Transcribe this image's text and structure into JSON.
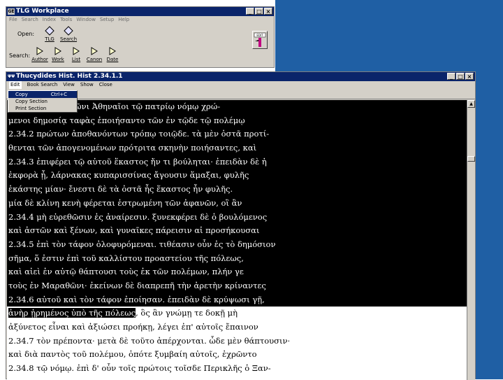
{
  "tlg_window": {
    "title": "TLG Workplace",
    "menu": [
      "File",
      "Search",
      "Index",
      "Tools",
      "Window",
      "Setup",
      "Help"
    ],
    "open_label": "Open:",
    "search_label": "Search:",
    "open_tools": [
      "TLG",
      "Search"
    ],
    "search_tools": [
      "Author",
      "Work",
      "List",
      "Canon",
      "Date"
    ],
    "edit_badge": "EDIT"
  },
  "thuc_window": {
    "title": "Thucydides Hist.   Hist 2.34.1.1",
    "menu": [
      "Edit",
      "Book Search",
      "View",
      "Show",
      "Close"
    ],
    "edit_menu": [
      {
        "label": "Copy",
        "shortcut": "Ctrl+C"
      },
      {
        "label": "Copy Section",
        "shortcut": ""
      },
      {
        "label": "Print Section",
        "shortcut": ""
      }
    ],
    "lines": [
      "ἐν τῷ αὐτῷ χειμῶνι Ἀθηναῖοι τῷ πατρίῳ νόμῳ χρώ-",
      "μενοι δημοσίᾳ ταφὰς ἐποιήσαντο τῶν ἐν τῷδε τῷ πολέμῳ",
      "2.34.2 πρώτων ἀποθανόντων τρόπῳ τοιῷδε. τὰ μὲν ὀστᾶ προτί-",
      "θενται τῶν ἀπογενομένων πρότριτα σκηνὴν ποιήσαντες, καὶ",
      "2.34.3 ἐπιφέρει τῷ αὑτοῦ ἕκαστος ἤν τι βούληται· ἐπειδὰν δὲ ἡ",
      "ἐκφορὰ ᾖ, λάρνακας κυπαρισσίνας ἄγουσιν ἅμαξαι, φυλῆς",
      "ἑκάστης μίαν· ἔνεστι δὲ τὰ ὀστᾶ ἧς ἕκαστος ἦν φυλῆς.",
      "μία δὲ κλίνη κενὴ φέρεται ἐστρωμένη τῶν ἀφανῶν, οἳ ἂν",
      "2.34.4 μὴ εὑρεθῶσιν ἐς ἀναίρεσιν. ξυνεκφέρει δὲ ὁ βουλόμενος",
      "καὶ ἀστῶν καὶ ξένων, καὶ γυναῖκες πάρεισιν αἱ προσήκουσαι",
      "2.34.5 ἐπὶ τὸν τάφον ὀλοφυρόμεναι. τιθέασιν οὖν ἐς τὸ δημόσιον",
      "σῆμα, ὅ ἐστιν ἐπὶ τοῦ καλλίστου προαστείου τῆς πόλεως,",
      "καὶ αἰεὶ ἐν αὐτῷ θάπτουσι τοὺς ἐκ τῶν πολέμων, πλήν γε",
      "τοὺς ἐν Μαραθῶνι· ἐκείνων δὲ διαπρεπῆ τὴν ἀρετὴν κρίναντες",
      "2.34.6 αὐτοῦ καὶ τὸν τάφον ἐποίησαν. ἐπειδὰν δὲ κρύψωσι γῇ,",
      "ἀνὴρ ᾑρημένος ὑπὸ τῆς πόλεως",
      ", ὃς ἂν γνώμῃ τε δοκῇ μὴ",
      "ἀξύνετος εἶναι καὶ ἀξιώσει προήκῃ, λέγει ἐπ' αὐτοῖς ἔπαινον",
      "2.34.7 τὸν πρέποντα· μετὰ δὲ τοῦτο ἀπέρχονται. ὧδε μὲν θάπτουσιν·",
      "καὶ διὰ παντὸς τοῦ πολέμου, ὁπότε ξυμβαίη αὐτοῖς, ἐχρῶντο",
      "2.34.8 τῷ νόμῳ. ἐπὶ δ' οὖν τοῖς πρώτοις τοῖσδε Περικλῆς ὁ Ξαν-"
    ]
  }
}
